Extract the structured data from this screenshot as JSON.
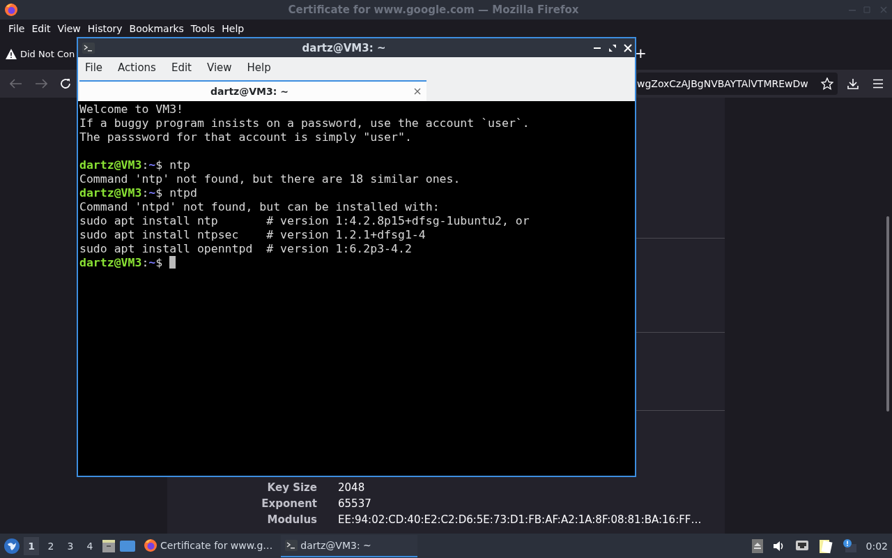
{
  "browser": {
    "title": "Certificate for www.google.com — Mozilla Firefox",
    "menu": [
      "File",
      "Edit",
      "View",
      "History",
      "Bookmarks",
      "Tools",
      "Help"
    ],
    "tab": {
      "label": "Did Not Con"
    },
    "new_tab": "+",
    "url": {
      "value": "wgZoxCzAJBgNVBAYTAlVTMREwDw"
    },
    "certificate": {
      "rows": [
        {
          "label": "Key Size",
          "value": "2048"
        },
        {
          "label": "Exponent",
          "value": "65537"
        },
        {
          "label": "Modulus",
          "value": "EE:94:02:CD:40:E2:C2:D6:5E:73:D1:FB:AF:A2:1A:8F:08:81:BA:16:FF…"
        }
      ]
    }
  },
  "terminal": {
    "title": "dartz@VM3: ~",
    "menu": [
      "File",
      "Actions",
      "Edit",
      "View",
      "Help"
    ],
    "tabs": [
      {
        "label": "dartz@VM3: ~",
        "selected": true
      }
    ],
    "lines": [
      {
        "kind": "output",
        "text": "Welcome to VM3!"
      },
      {
        "kind": "output",
        "text": "If a buggy program insists on a password, use the account `user`."
      },
      {
        "kind": "output",
        "text": "The passsword for that account is simply \"user\"."
      },
      {
        "kind": "blank"
      },
      {
        "kind": "prompt",
        "user": "dartz@VM3",
        "sep": ":",
        "path": "~",
        "sign": "$",
        "command": "ntp"
      },
      {
        "kind": "output",
        "text": "Command 'ntp' not found, but there are 18 similar ones."
      },
      {
        "kind": "prompt",
        "user": "dartz@VM3",
        "sep": ":",
        "path": "~",
        "sign": "$",
        "command": "ntpd"
      },
      {
        "kind": "output",
        "text": "Command 'ntpd' not found, but can be installed with:"
      },
      {
        "kind": "output",
        "text": "sudo apt install ntp       # version 1:4.2.8p15+dfsg-1ubuntu2, or"
      },
      {
        "kind": "output",
        "text": "sudo apt install ntpsec    # version 1.2.1+dfsg1-4"
      },
      {
        "kind": "output",
        "text": "sudo apt install openntpd  # version 1:6.2p3-4.2"
      },
      {
        "kind": "prompt",
        "user": "dartz@VM3",
        "sep": ":",
        "path": "~",
        "sign": "$",
        "cursor": true
      }
    ]
  },
  "taskbar": {
    "desktops": [
      {
        "label": "1",
        "selected": true
      },
      {
        "label": "2",
        "selected": false
      },
      {
        "label": "3",
        "selected": false
      },
      {
        "label": "4",
        "selected": false
      }
    ],
    "tasks": [
      {
        "kind": "firefox",
        "label": "Certificate for www.g…",
        "selected": false
      },
      {
        "kind": "terminal",
        "label": "dartz@VM3: ~",
        "selected": true
      }
    ],
    "clock": "0:02"
  }
}
